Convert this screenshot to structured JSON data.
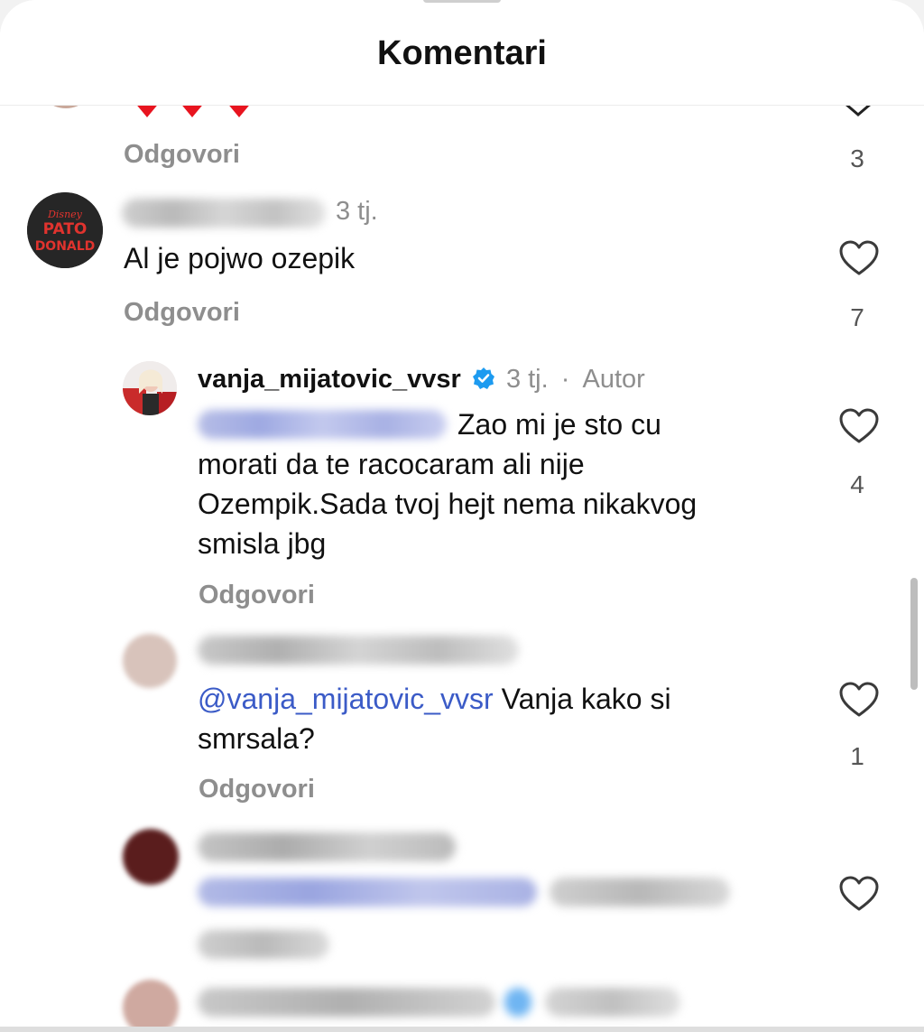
{
  "header": {
    "title": "Komentari"
  },
  "top_partial": {
    "reply_label": "Odgovori",
    "like_count": "3",
    "emoji_count": 3
  },
  "comments": [
    {
      "time": "3 tj.",
      "text": "Al je pojwo ozepik",
      "reply_label": "Odgovori",
      "like_count": "7",
      "avatar_text": [
        "Disney",
        "PATO",
        "DONALD"
      ]
    },
    {
      "username": "vanja_mijatovic_vvsr",
      "verified": true,
      "time": "3 tj.",
      "separator": "·",
      "author_label": "Autor",
      "text_lines": [
        "Zao mi je sto cu",
        "morati da te racocaram ali nije",
        "Ozempik.Sada tvoj hejt nema nikakvog",
        "smisla jbg"
      ],
      "reply_label": "Odgovori",
      "like_count": "4"
    },
    {
      "mention": "@vanja_mijatovic_vvsr",
      "text_after_mention": "Vanja kako si",
      "text_line2": "smrsala?",
      "reply_label": "Odgovori",
      "like_count": "1"
    }
  ],
  "colors": {
    "accent_link": "#3b5bc7",
    "verified_badge": "#1d9bf0",
    "heart_emoji": "#e8141f",
    "muted_text": "#8e8e8e"
  },
  "icons": [
    "heart-outline-icon",
    "verified-badge-icon",
    "chevron-down-icon",
    "red-heart-emoji"
  ]
}
